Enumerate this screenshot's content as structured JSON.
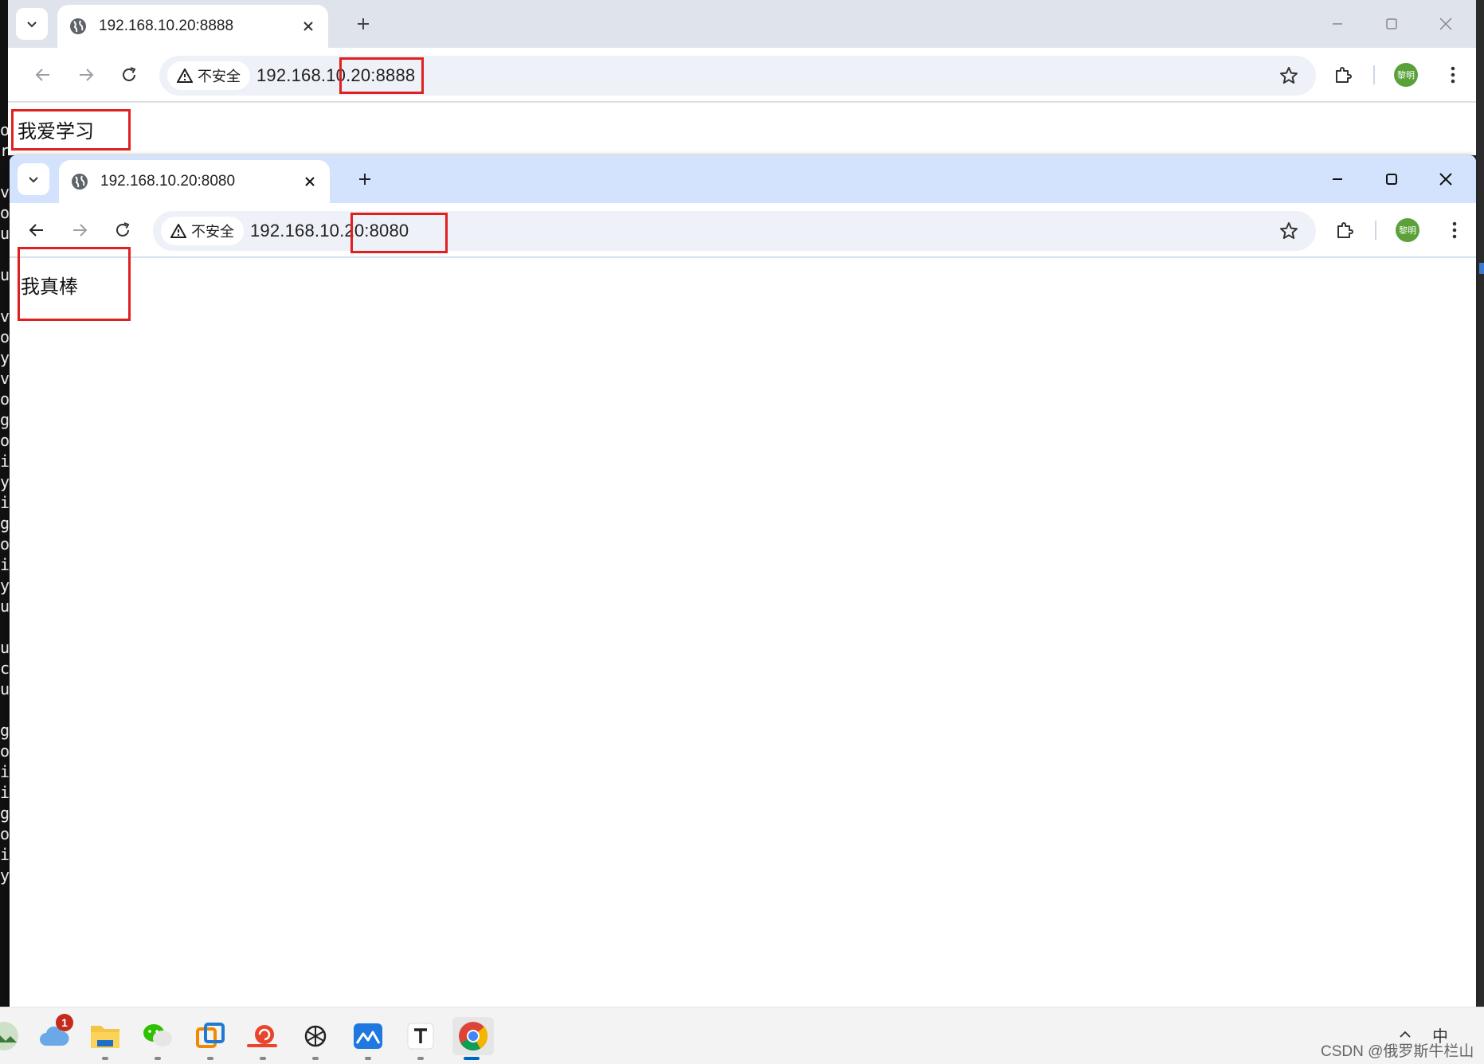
{
  "terminal": {
    "chars": [
      "o",
      "r",
      "",
      "v",
      "o",
      "u",
      "",
      "u",
      "",
      "v",
      "o",
      "y",
      "v",
      "o",
      "g",
      "o",
      "i",
      "y",
      "i",
      "g",
      "o",
      "i",
      "y",
      "u",
      "",
      "u",
      "c",
      "u",
      "",
      "g",
      "o",
      "i",
      "i",
      "g",
      "o",
      "i",
      "y"
    ]
  },
  "browser_back": {
    "tab_title": "192.168.10.20:8888",
    "security_label": "不安全",
    "url": "192.168.10.20:8888",
    "profile_initials": "黎明",
    "page_text": "我爱学习"
  },
  "browser_front": {
    "tab_title": "192.168.10.20:8080",
    "security_label": "不安全",
    "url": "192.168.10.20:8080",
    "profile_initials": "黎明",
    "page_text": "我真棒"
  },
  "taskbar": {
    "notification_count": "1",
    "apps": [
      "weather-app",
      "file-explorer",
      "wechat",
      "vmware",
      "snail-app",
      "chatgpt",
      "whiteboard-app",
      "typora",
      "chrome"
    ],
    "ime_label": "中",
    "watermark": "CSDN @俄罗斯牛栏山"
  },
  "colors": {
    "annotation_red": "#e02020",
    "front_tabstrip": "#d3e3fd",
    "back_tabstrip": "#dfe3eb"
  }
}
